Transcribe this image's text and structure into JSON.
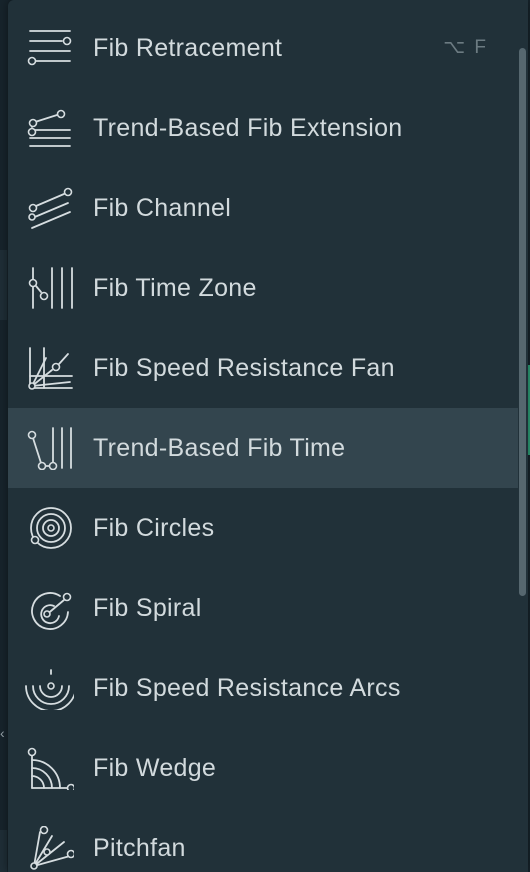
{
  "menu": {
    "items": [
      {
        "label": "Fib Retracement",
        "icon": "fib-retracement-icon",
        "shortcut": "⌥ F"
      },
      {
        "label": "Trend-Based Fib Extension",
        "icon": "trend-based-fib-extension-icon"
      },
      {
        "label": "Fib Channel",
        "icon": "fib-channel-icon"
      },
      {
        "label": "Fib Time Zone",
        "icon": "fib-time-zone-icon"
      },
      {
        "label": "Fib Speed Resistance Fan",
        "icon": "fib-speed-resistance-fan-icon"
      },
      {
        "label": "Trend-Based Fib Time",
        "icon": "trend-based-fib-time-icon",
        "hovered": true
      },
      {
        "label": "Fib Circles",
        "icon": "fib-circles-icon"
      },
      {
        "label": "Fib Spiral",
        "icon": "fib-spiral-icon"
      },
      {
        "label": "Fib Speed Resistance Arcs",
        "icon": "fib-speed-resistance-arcs-icon"
      },
      {
        "label": "Fib Wedge",
        "icon": "fib-wedge-icon"
      },
      {
        "label": "Pitchfan",
        "icon": "pitchfan-icon"
      }
    ]
  },
  "colors": {
    "menu_background": "#213139",
    "hover_background": "#33454e",
    "text": "#d2dadd",
    "shortcut_text": "#6c7b82",
    "accent_green": "#2fa37a"
  }
}
